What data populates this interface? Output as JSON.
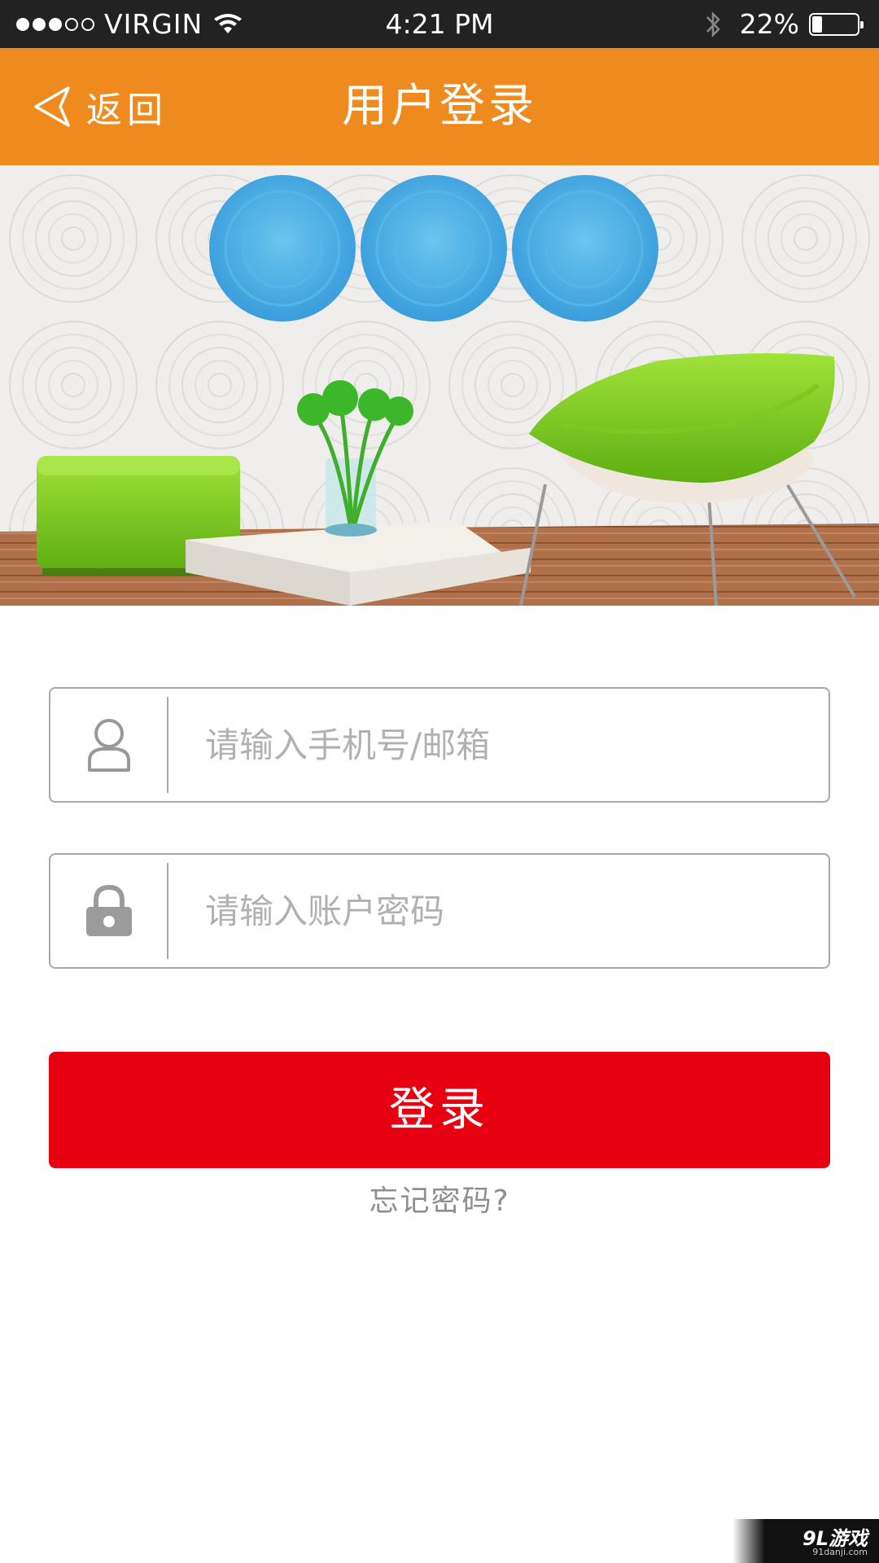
{
  "status_bar": {
    "carrier": "VIRGIN",
    "signal_bars": 3,
    "signal_total": 5,
    "time": "4:21 PM",
    "battery_text": "22%",
    "battery_level": 0.22,
    "icons": [
      "wifi-icon",
      "bluetooth-icon",
      "battery-icon"
    ]
  },
  "nav": {
    "back_label": "返回",
    "title": "用户登录",
    "background": "#ef8a1f"
  },
  "form": {
    "account_placeholder": "请输入手机号/邮箱",
    "account_icon": "user-icon",
    "password_placeholder": "请输入账户密码",
    "password_icon": "lock-icon",
    "login_label": "登录",
    "login_color": "#e60012",
    "forgot_label": "忘记密码?"
  },
  "watermark": {
    "text": "9L游戏",
    "subtext": "91danji.com"
  }
}
